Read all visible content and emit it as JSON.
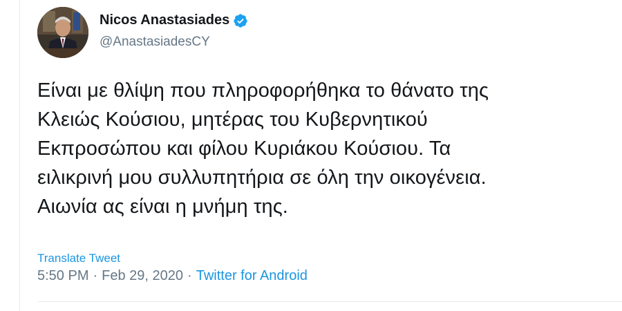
{
  "user": {
    "display_name": "Nicos Anastasiades",
    "handle": "@AnastasiadesCY",
    "verified_icon": "verified-badge-icon",
    "avatar": "profile-photo"
  },
  "tweet": {
    "lines": [
      "Είναι με θλίψη που πληροφορήθηκα το θάνατο της",
      "Κλειώς Κούσιου, μητέρας του Κυβερνητικού",
      "Εκπροσώπου και φίλου Κυριάκου Κούσιου. Τα",
      "ειλικρινή μου συλλυπητήρια σε όλη την οικογένεια.",
      "Αιωνία ας είναι η μνήμη της."
    ],
    "translate_label": "Translate Tweet",
    "time": "5:50 PM",
    "separator": "·",
    "date": "Feb 29, 2020",
    "source": "Twitter for Android"
  },
  "colors": {
    "link": "#1b95e0",
    "secondary_text": "#657786",
    "primary_text": "#14171a",
    "verified": "#1da1f2",
    "divider": "#e6ecf0"
  }
}
